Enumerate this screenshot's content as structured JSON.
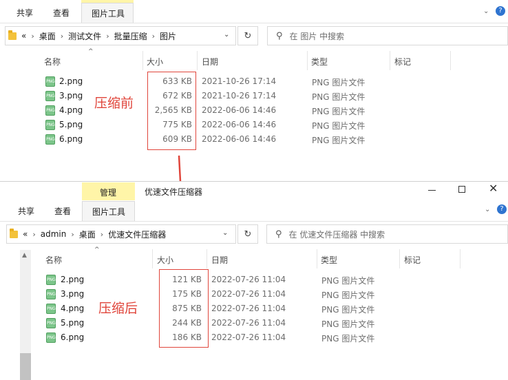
{
  "top_window": {
    "tabs": [
      "共享",
      "查看"
    ],
    "tools_tab": "图片工具",
    "breadcrumb": [
      "«",
      "桌面",
      "测试文件",
      "批量压缩",
      "图片"
    ],
    "search_placeholder": "在 图片 中搜索",
    "columns": [
      "名称",
      "大小",
      "日期",
      "类型",
      "标记"
    ],
    "files": [
      {
        "name": "2.png",
        "size": "633 KB",
        "date": "2021-10-26 17:14",
        "type": "PNG 图片文件"
      },
      {
        "name": "3.png",
        "size": "672 KB",
        "date": "2021-10-26 17:14",
        "type": "PNG 图片文件"
      },
      {
        "name": "4.png",
        "size": "2,565 KB",
        "date": "2022-06-06 14:46",
        "type": "PNG 图片文件"
      },
      {
        "name": "5.png",
        "size": "775 KB",
        "date": "2022-06-06 14:46",
        "type": "PNG 图片文件"
      },
      {
        "name": "6.png",
        "size": "609 KB",
        "date": "2022-06-06 14:46",
        "type": "PNG 图片文件"
      }
    ],
    "annotation": "压缩前"
  },
  "bottom_window": {
    "manage_tab": "管理",
    "title": "优速文件压缩器",
    "tabs": [
      "共享",
      "查看"
    ],
    "tools_tab": "图片工具",
    "breadcrumb": [
      "«",
      "admin",
      "桌面",
      "优速文件压缩器"
    ],
    "search_placeholder": "在 优速文件压缩器 中搜索",
    "columns": [
      "名称",
      "大小",
      "日期",
      "类型",
      "标记"
    ],
    "files": [
      {
        "name": "2.png",
        "size": "121 KB",
        "date": "2022-07-26 11:04",
        "type": "PNG 图片文件"
      },
      {
        "name": "3.png",
        "size": "175 KB",
        "date": "2022-07-26 11:04",
        "type": "PNG 图片文件"
      },
      {
        "name": "4.png",
        "size": "875 KB",
        "date": "2022-07-26 11:04",
        "type": "PNG 图片文件"
      },
      {
        "name": "5.png",
        "size": "244 KB",
        "date": "2022-07-26 11:04",
        "type": "PNG 图片文件"
      },
      {
        "name": "6.png",
        "size": "186 KB",
        "date": "2022-07-26 11:04",
        "type": "PNG 图片文件"
      }
    ],
    "annotation": "压缩后"
  },
  "icons": {
    "png": "PNG"
  },
  "colors": {
    "highlight": "#e0453b",
    "tools_tab": "#fff5a8",
    "folder": "#f3c23b"
  }
}
